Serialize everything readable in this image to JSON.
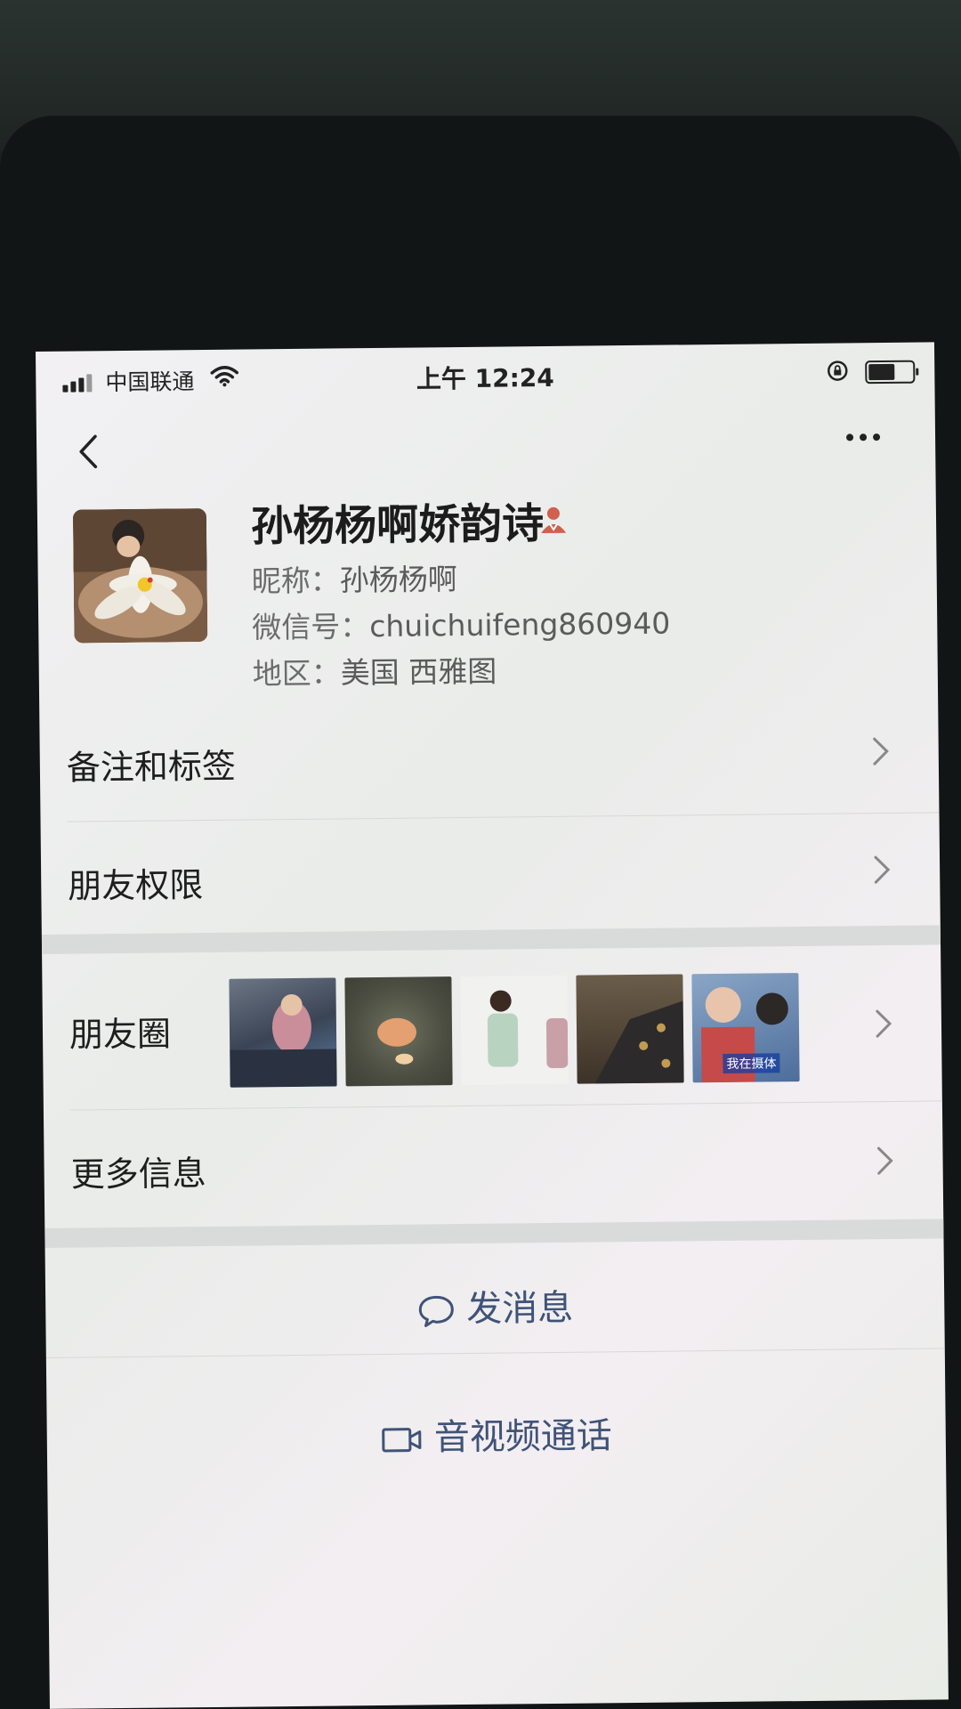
{
  "status_bar": {
    "carrier": "中国联通",
    "time": "上午 12:24",
    "battery_level": 0.6
  },
  "nav": {
    "back_icon": "chevron-left-icon",
    "more_icon": "more-dots-icon"
  },
  "profile": {
    "display_name": "孙杨杨啊娇韵诗",
    "nickname_label": "昵称：",
    "nickname": "孙杨杨啊",
    "wechat_id_label": "微信号：",
    "wechat_id": "chuichuifeng860940",
    "region_label": "地区：",
    "region": "美国 西雅图",
    "gender_icon": "female-icon"
  },
  "menu": {
    "remark_tags": "备注和标签",
    "friend_permissions": "朋友权限",
    "moments": "朋友圈",
    "more_info": "更多信息"
  },
  "moments_thumbs": {
    "last_caption": "我在摄体"
  },
  "actions": {
    "send_message": "发消息",
    "av_call": "音视频通话"
  },
  "colors": {
    "action_text": "#3f5378",
    "gender_icon": "#d0604f"
  }
}
